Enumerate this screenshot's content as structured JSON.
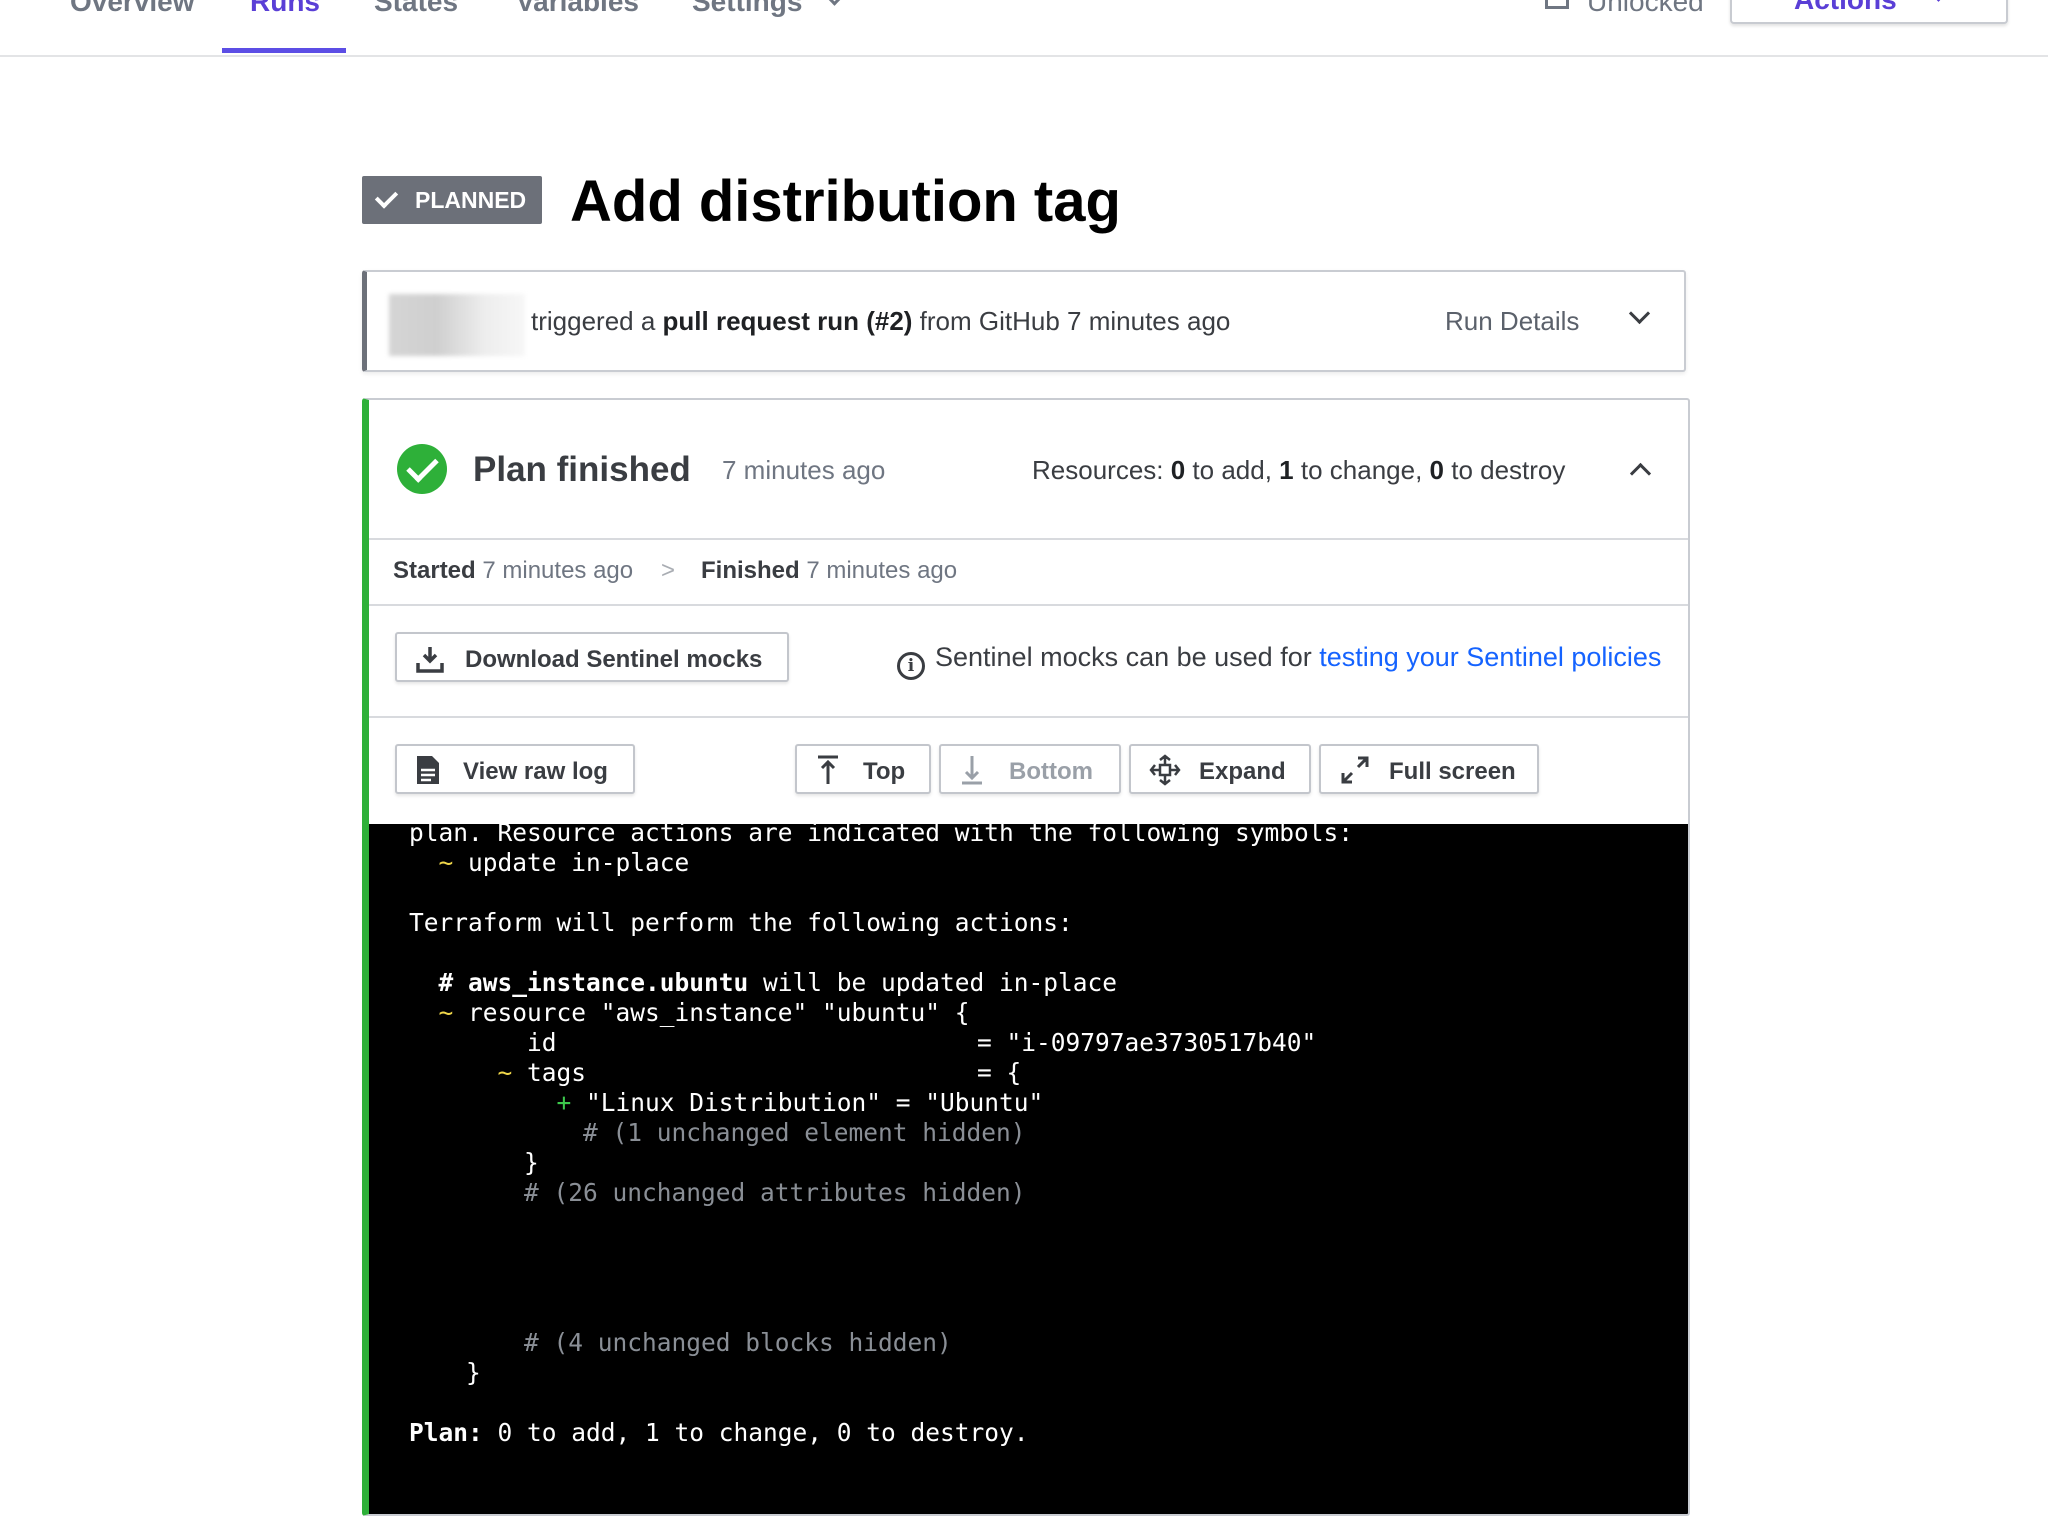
{
  "nav": {
    "tabs": [
      {
        "label": "Overview"
      },
      {
        "label": "Runs"
      },
      {
        "label": "States"
      },
      {
        "label": "Variables"
      },
      {
        "label": "Settings"
      }
    ],
    "active_tab": "Runs",
    "lock_status": "Unlocked",
    "actions_label": "Actions"
  },
  "title": {
    "badge": "PLANNED",
    "heading": "Add distribution tag"
  },
  "trigger": {
    "prefix": "triggered a ",
    "run_type": "pull request run (#2)",
    "suffix": " from GitHub 7 minutes ago",
    "details_label": "Run Details"
  },
  "plan": {
    "title": "Plan finished",
    "time": "7 minutes ago",
    "resources": {
      "prefix": "Resources: ",
      "add": "0",
      "add_label": " to add, ",
      "change": "1",
      "change_label": " to change, ",
      "destroy": "0",
      "destroy_label": " to destroy"
    },
    "timeline": {
      "started_label": "Started",
      "started_time": "7 minutes ago",
      "separator": ">",
      "finished_label": "Finished",
      "finished_time": "7 minutes ago"
    },
    "mocks": {
      "download_label": "Download Sentinel mocks",
      "info_text": "Sentinel mocks can be used for ",
      "info_link": "testing your Sentinel policies"
    },
    "log_controls": {
      "view_raw": "View raw log",
      "top": "Top",
      "bottom": "Bottom",
      "expand": "Expand",
      "fullscreen": "Full screen"
    }
  },
  "terminal": {
    "l1": "plan. Resource actions are indicated with the following symbols:",
    "l2_sym": "~",
    "l2_text": " update in-place",
    "l3": "Terraform will perform the following actions:",
    "l4_hash": "# ",
    "l4_res": "aws_instance.ubuntu",
    "l4_text": " will be updated in-place",
    "l5_sym": "~",
    "l5_text": " resource \"aws_instance\" \"ubuntu\" {",
    "l6_key": "id",
    "l6_val": "= \"i-09797ae3730517b40\"",
    "l7_sym": "~",
    "l7_key": " tags",
    "l7_val": "= {",
    "l8_sym": "+",
    "l8_text": " \"Linux Distribution\" = \"Ubuntu\"",
    "l9": "# (1 unchanged element hidden)",
    "l10": "}",
    "l11": "# (26 unchanged attributes hidden)",
    "l12": "# (4 unchanged blocks hidden)",
    "l13": "}",
    "l14_label": "Plan:",
    "l14_text": " 0 to add, 1 to change, 0 to destroy."
  },
  "colors": {
    "accent": "#5c4ee5",
    "success": "#2eb039",
    "badge": "#6c7079",
    "link": "#1563ff"
  }
}
